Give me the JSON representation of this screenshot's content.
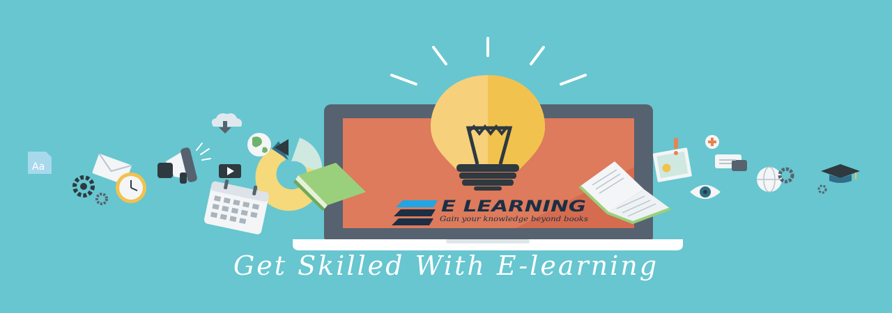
{
  "banner": {
    "slogan": "Get Skilled With E-learning",
    "logo": {
      "wordmark": "E LEARNING",
      "tagline": "Gain your knowledge beyond books"
    }
  },
  "colors": {
    "background": "#67c6cf",
    "screen": "#dd7b5c",
    "bulb": "#f2c24e",
    "slogan": "#ffffff",
    "logo_dark": "#1b2f45",
    "logo_accent": "#1ea6e6"
  },
  "icons": [
    "font-icon",
    "envelope-icon",
    "gears-icon",
    "clock-icon",
    "megaphone-icon",
    "cloud-download-icon",
    "video-play-icon",
    "calendar-icon",
    "globe-icon",
    "pie-chart-icon",
    "book-icon",
    "lightbulb-icon",
    "open-book-icon",
    "alert-icon",
    "photo-icon",
    "medical-icon",
    "chat-icon",
    "eye-icon",
    "world-gear-icon",
    "graduation-cap-icon"
  ]
}
